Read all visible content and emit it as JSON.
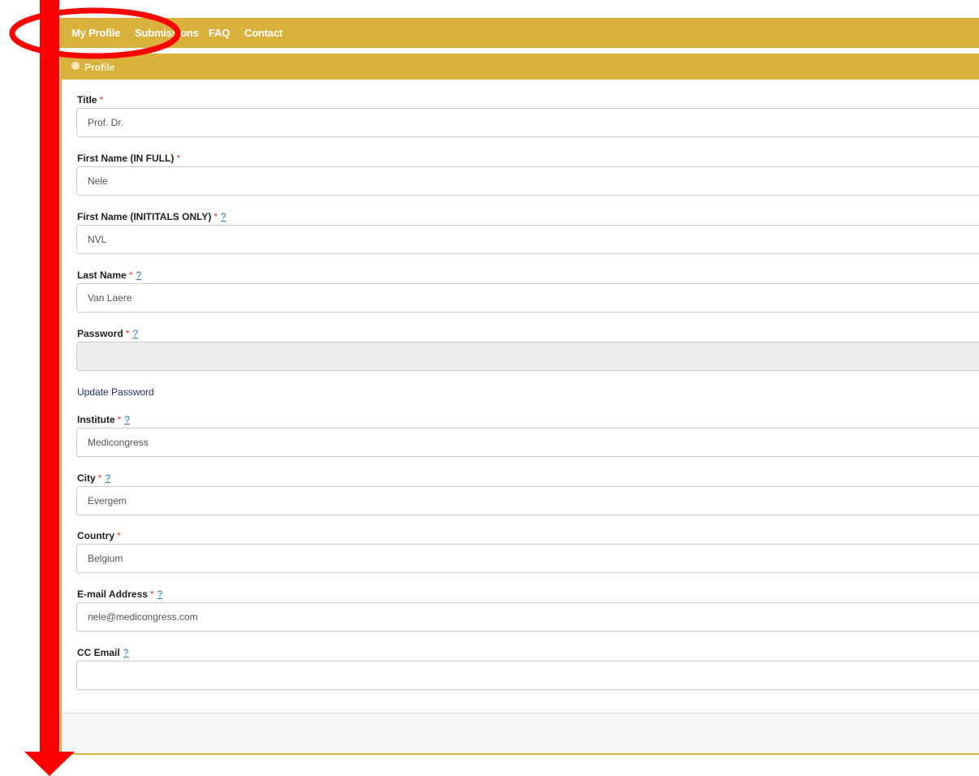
{
  "nav": {
    "items": [
      {
        "label": "My Profile"
      },
      {
        "label": "Submissions"
      },
      {
        "label": "FAQ"
      },
      {
        "label": "Contact"
      }
    ]
  },
  "panel": {
    "title": "Profile"
  },
  "form": {
    "required_mark": "*",
    "help_mark": "?",
    "title": {
      "label": "Title",
      "value": "Prof. Dr."
    },
    "first_name_full": {
      "label": "First Name (IN FULL)",
      "value": "Nele"
    },
    "first_name_initials": {
      "label": "First Name (INITITALS ONLY)",
      "value": "NVL"
    },
    "last_name": {
      "label": "Last Name",
      "value": "Van Laere"
    },
    "password": {
      "label": "Password",
      "value": ""
    },
    "update_password": "Update Password",
    "institute": {
      "label": "Institute",
      "value": "Medicongress"
    },
    "city": {
      "label": "City",
      "value": "Evergem"
    },
    "country": {
      "label": "Country",
      "value": "Belgium"
    },
    "email": {
      "label": "E-mail Address",
      "value": "nele@medicongress.com"
    },
    "cc_email": {
      "label": "CC Email",
      "value": ""
    }
  },
  "colors": {
    "brand": "#d9b13c",
    "required": "#e0342f",
    "help_link": "#2a74c6",
    "annotation": "#ff0000"
  },
  "icons": {
    "panel_header": "user-icon"
  }
}
